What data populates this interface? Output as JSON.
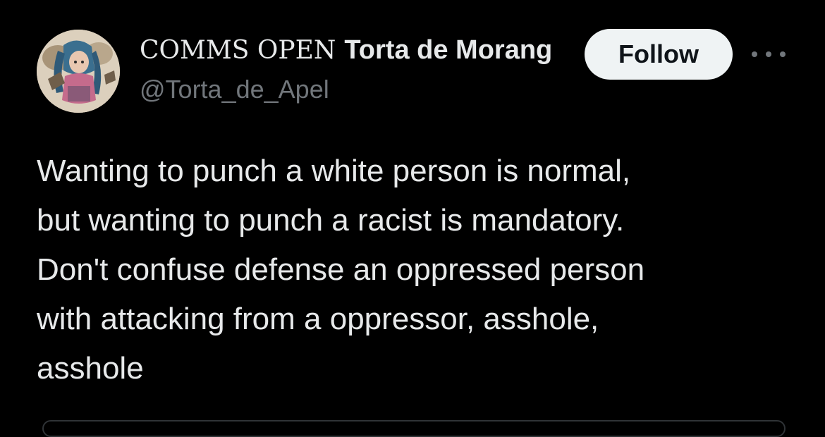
{
  "author": {
    "display_name_prefix": "COMMS OPEN",
    "display_name_main": "Torta de Morang",
    "handle": "@Torta_de_Apel",
    "avatar_icon": "anime-character-avatar"
  },
  "actions": {
    "follow_label": "Follow",
    "more_icon": "ellipsis-icon"
  },
  "tweet": {
    "text": "Wanting to punch a white person is normal,\nbut wanting to punch a racist is mandatory.\nDon't confuse defense an oppressed person\nwith attacking from a oppressor, asshole,\nasshole"
  },
  "colors": {
    "background": "#000000",
    "text_primary": "#e7e9ea",
    "text_secondary": "#71767b",
    "follow_button_bg": "#eff3f4",
    "follow_button_text": "#0f1419"
  }
}
